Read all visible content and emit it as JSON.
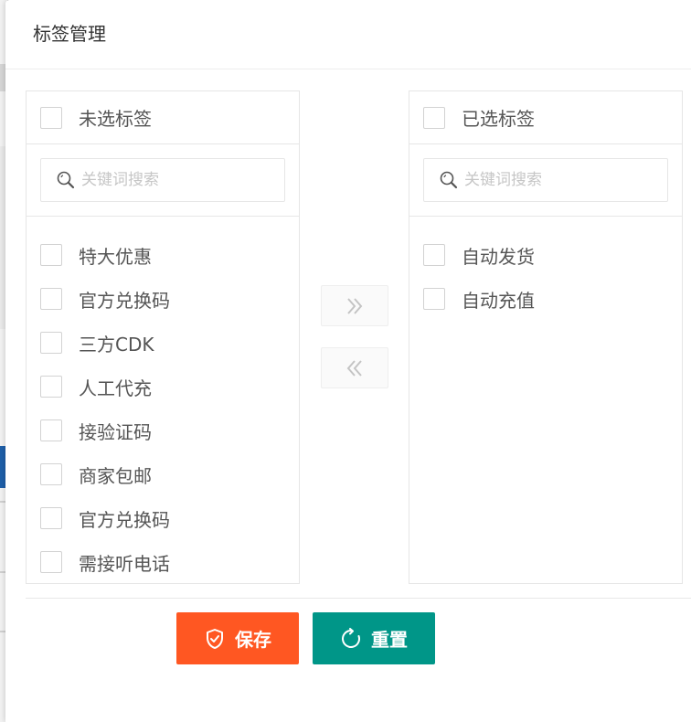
{
  "dialog": {
    "title": "标签管理"
  },
  "left_panel": {
    "title": "未选标签",
    "search_placeholder": "关键词搜索",
    "items": [
      {
        "label": "特大优惠"
      },
      {
        "label": "官方兑换码"
      },
      {
        "label": "三方CDK"
      },
      {
        "label": "人工代充"
      },
      {
        "label": "接验证码"
      },
      {
        "label": "商家包邮"
      },
      {
        "label": "官方兑换码"
      },
      {
        "label": "需接听电话"
      }
    ]
  },
  "right_panel": {
    "title": "已选标签",
    "search_placeholder": "关键词搜索",
    "items": [
      {
        "label": "自动发货"
      },
      {
        "label": "自动充值"
      }
    ]
  },
  "actions": {
    "save_label": "保存",
    "reset_label": "重置"
  },
  "colors": {
    "save": "#ff5722",
    "reset": "#009688",
    "border": "#e6e6e6"
  },
  "icons": {
    "search": "search-icon",
    "move_right": "double-chevron-right-icon",
    "move_left": "double-chevron-left-icon",
    "save": "shield-check-icon",
    "reset": "refresh-icon"
  }
}
